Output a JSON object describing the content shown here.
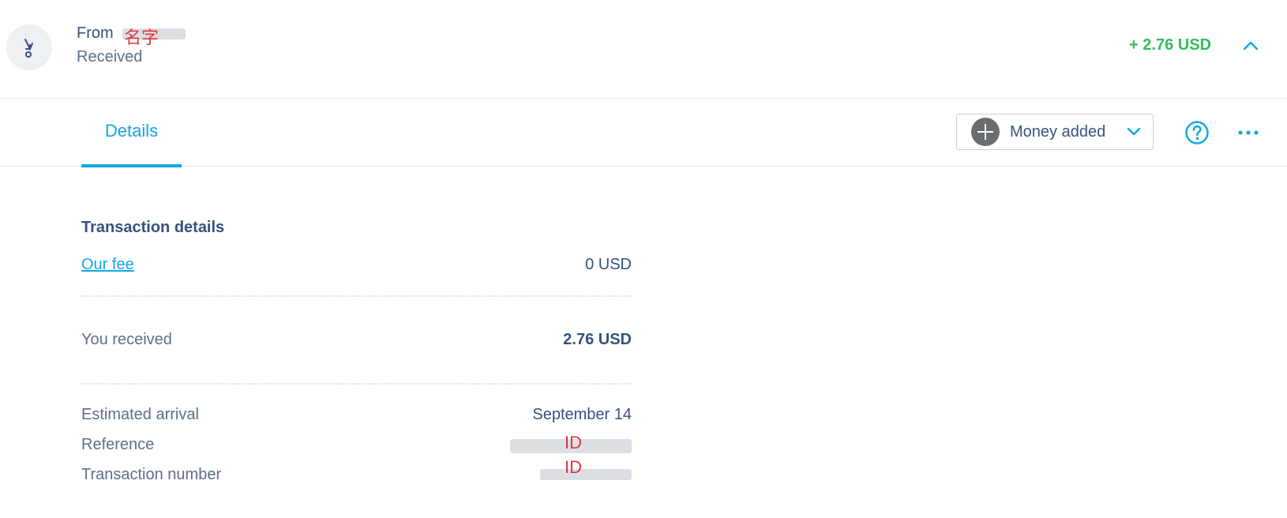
{
  "header": {
    "from_prefix": "From",
    "sender_annotation": "名字",
    "status": "Received",
    "amount": "+ 2.76 USD"
  },
  "tabs": [
    {
      "label": "Details"
    }
  ],
  "category": {
    "label": "Money added"
  },
  "details": {
    "title": "Transaction details",
    "fee_label": "Our fee",
    "fee_value": "0 USD",
    "received_label": "You received",
    "received_value": "2.76 USD",
    "arrival_label": "Estimated arrival",
    "arrival_value": "September 14",
    "reference_label": "Reference",
    "reference_annotation": "ID",
    "txn_label": "Transaction number",
    "txn_annotation": "ID"
  },
  "colors": {
    "accent": "#12a7e6",
    "positive": "#2ebf5a",
    "text": "#37517e",
    "annotation": "#e0363a"
  }
}
